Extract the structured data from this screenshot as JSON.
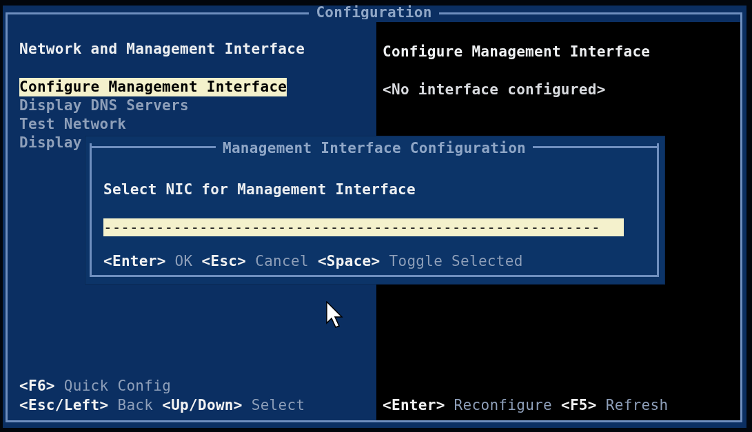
{
  "window": {
    "title": "Configuration"
  },
  "left_panel": {
    "heading": "Network and Management Interface",
    "menu": [
      {
        "label": "Configure Management Interface",
        "selected": true
      },
      {
        "label": "Display DNS Servers",
        "selected": false
      },
      {
        "label": "Test Network",
        "selected": false
      },
      {
        "label": "Display",
        "selected": false
      }
    ],
    "footer": [
      [
        {
          "key": "<F6>",
          "action": "Quick Config"
        }
      ],
      [
        {
          "key": "<Esc/Left>",
          "action": "Back"
        },
        {
          "key": "<Up/Down>",
          "action": "Select"
        }
      ]
    ]
  },
  "right_panel": {
    "heading": "Configure Management Interface",
    "status": "<No interface configured>",
    "footer": [
      {
        "key": "<Enter>",
        "action": "Reconfigure"
      },
      {
        "key": "<F5>",
        "action": "Refresh"
      }
    ]
  },
  "dialog": {
    "title": "Management Interface Configuration",
    "prompt": "Select NIC for Management Interface",
    "list_row": {
      "text": "---------------------------------------------------------",
      "selected": true
    },
    "footer": [
      {
        "key": "<Enter>",
        "action": "OK"
      },
      {
        "key": "<Esc>",
        "action": "Cancel"
      },
      {
        "key": "<Space>",
        "action": "Toggle Selected"
      }
    ]
  }
}
